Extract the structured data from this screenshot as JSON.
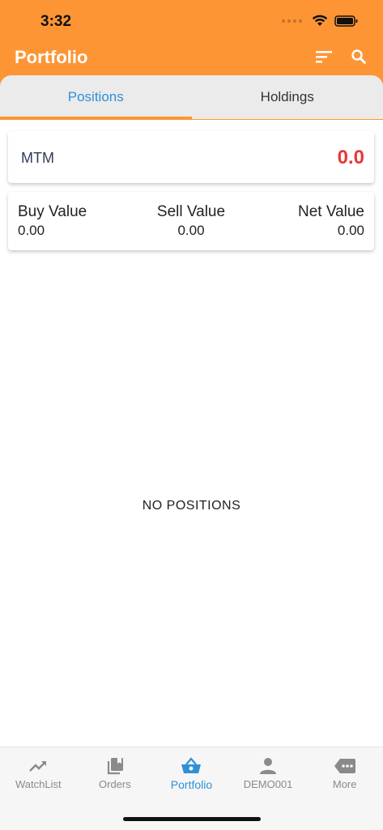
{
  "status": {
    "time": "3:32"
  },
  "header": {
    "title": "Portfolio"
  },
  "tabs": [
    {
      "label": "Positions",
      "active": true
    },
    {
      "label": "Holdings",
      "active": false
    }
  ],
  "mtm": {
    "label": "MTM",
    "value": "0.0",
    "value_color": "#e53935"
  },
  "summary": {
    "buy": {
      "label": "Buy Value",
      "value": "0.00"
    },
    "sell": {
      "label": "Sell Value",
      "value": "0.00"
    },
    "net": {
      "label": "Net Value",
      "value": "0.00"
    }
  },
  "empty_message": "NO POSITIONS",
  "bottom_nav": [
    {
      "label": "WatchList",
      "icon": "trending-up-icon"
    },
    {
      "label": "Orders",
      "icon": "stacked-pages-icon"
    },
    {
      "label": "Portfolio",
      "icon": "basket-icon",
      "active": true
    },
    {
      "label": "DEMO001",
      "icon": "person-icon"
    },
    {
      "label": "More",
      "icon": "more-dots-icon"
    }
  ],
  "colors": {
    "header": "#fd9535",
    "accent_blue": "#2f90d8",
    "loss_red": "#e53935"
  }
}
